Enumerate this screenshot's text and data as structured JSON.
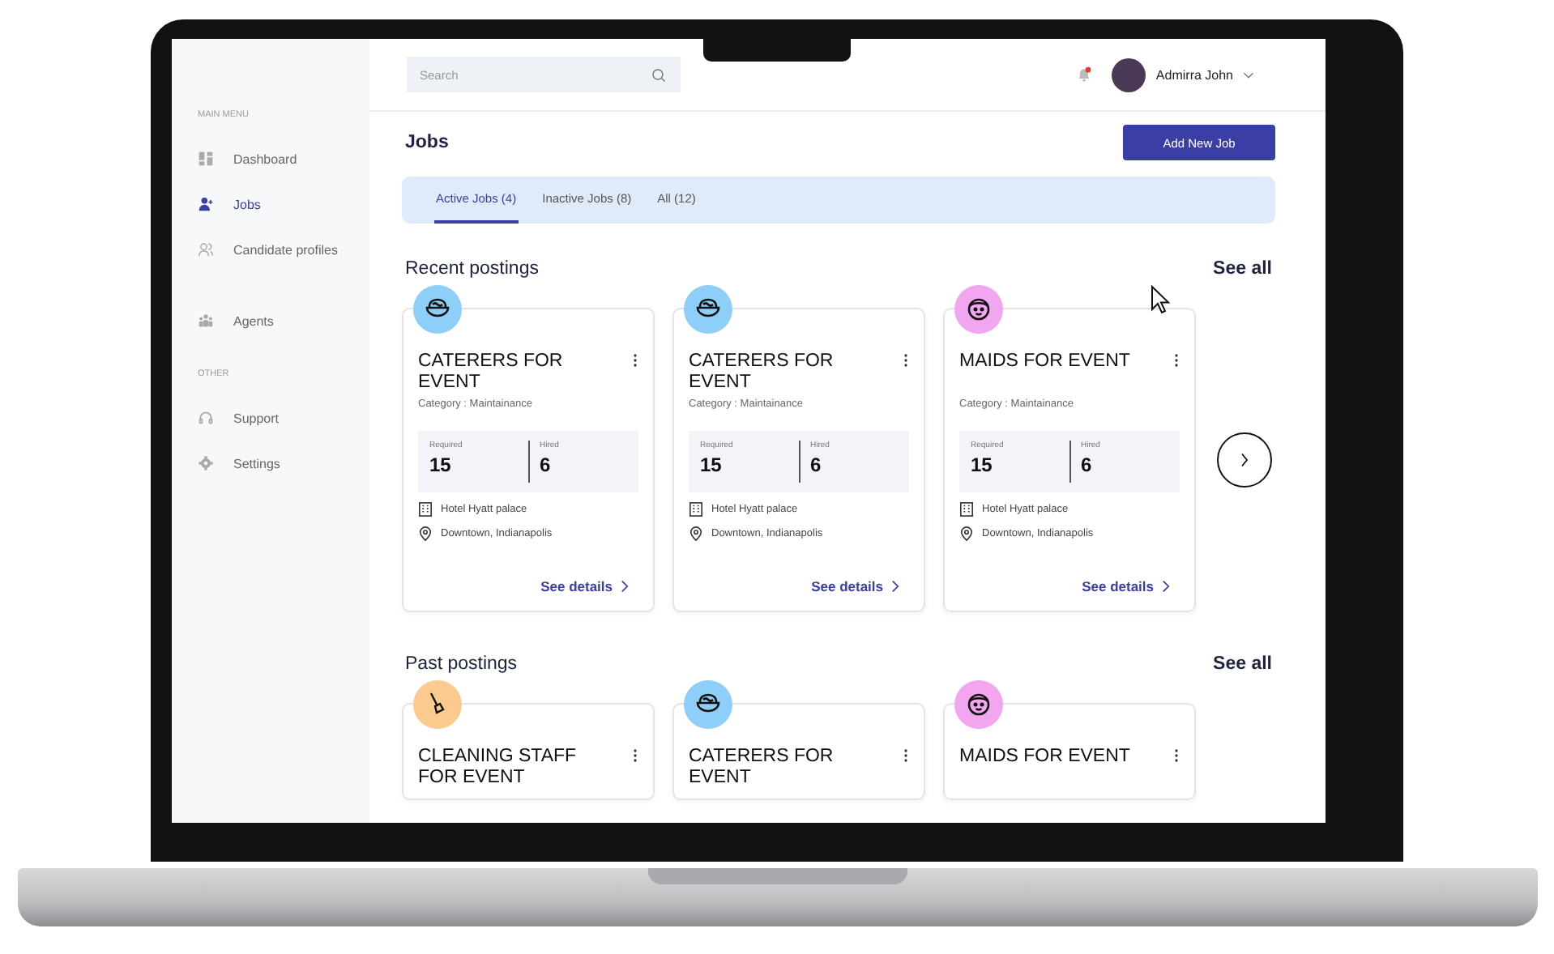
{
  "sidebar": {
    "sections": [
      {
        "label": "MAIN MENU",
        "items": [
          {
            "kind": "grid",
            "label": "Dashboard",
            "selected": false
          },
          {
            "kind": "user-plus",
            "label": "Jobs",
            "selected": true
          },
          {
            "kind": "users",
            "label": "Candidate profiles",
            "selected": false
          },
          {
            "kind": "group",
            "label": "Agents",
            "selected": false
          }
        ]
      },
      {
        "label": "OTHER",
        "items": [
          {
            "kind": "headset",
            "label": "Support",
            "selected": false
          },
          {
            "kind": "gear",
            "label": "Settings",
            "selected": false
          }
        ]
      }
    ]
  },
  "search": {
    "placeholder": "Search"
  },
  "notifications": {
    "unread": true
  },
  "user": {
    "name": "Admirra John"
  },
  "page_title": "Jobs",
  "add_button": "Add New Job",
  "tabs": [
    {
      "label": "Active Jobs (4)",
      "selected": true
    },
    {
      "label": "Inactive Jobs (8)",
      "selected": false
    },
    {
      "label": "All (12)",
      "selected": false
    }
  ],
  "recent": {
    "title": "Recent postings",
    "see_all": "See all",
    "cards": [
      {
        "kind": "food",
        "color": "#8ecffa",
        "title": "CATERERS FOR EVENT",
        "category": "Category : Maintainance",
        "required_label": "Required",
        "required": "15",
        "hired_label": "Hired",
        "hired": "6",
        "venue": "Hotel Hyatt palace",
        "location": "Downtown, Indianapolis",
        "link": "See details"
      },
      {
        "kind": "food",
        "color": "#8ecffa",
        "title": "CATERERS FOR EVENT",
        "category": "Category : Maintainance",
        "required_label": "Required",
        "required": "15",
        "hired_label": "Hired",
        "hired": "6",
        "venue": "Hotel Hyatt palace",
        "location": "Downtown, Indianapolis",
        "link": "See details"
      },
      {
        "kind": "face",
        "color": "#f2a6ef",
        "title": "MAIDS FOR EVENT",
        "category": "Category : Maintainance",
        "required_label": "Required",
        "required": "15",
        "hired_label": "Hired",
        "hired": "6",
        "venue": "Hotel Hyatt palace",
        "location": "Downtown, Indianapolis",
        "link": "See details"
      }
    ]
  },
  "past": {
    "title": "Past postings",
    "see_all": "See all",
    "cards": [
      {
        "kind": "broom",
        "color": "#fbca8f",
        "title": "CLEANING STAFF FOR EVENT"
      },
      {
        "kind": "food",
        "color": "#8ecffa",
        "title": "CATERERS FOR EVENT"
      },
      {
        "kind": "face",
        "color": "#f2a6ef",
        "title": "MAIDS FOR EVENT"
      }
    ]
  }
}
